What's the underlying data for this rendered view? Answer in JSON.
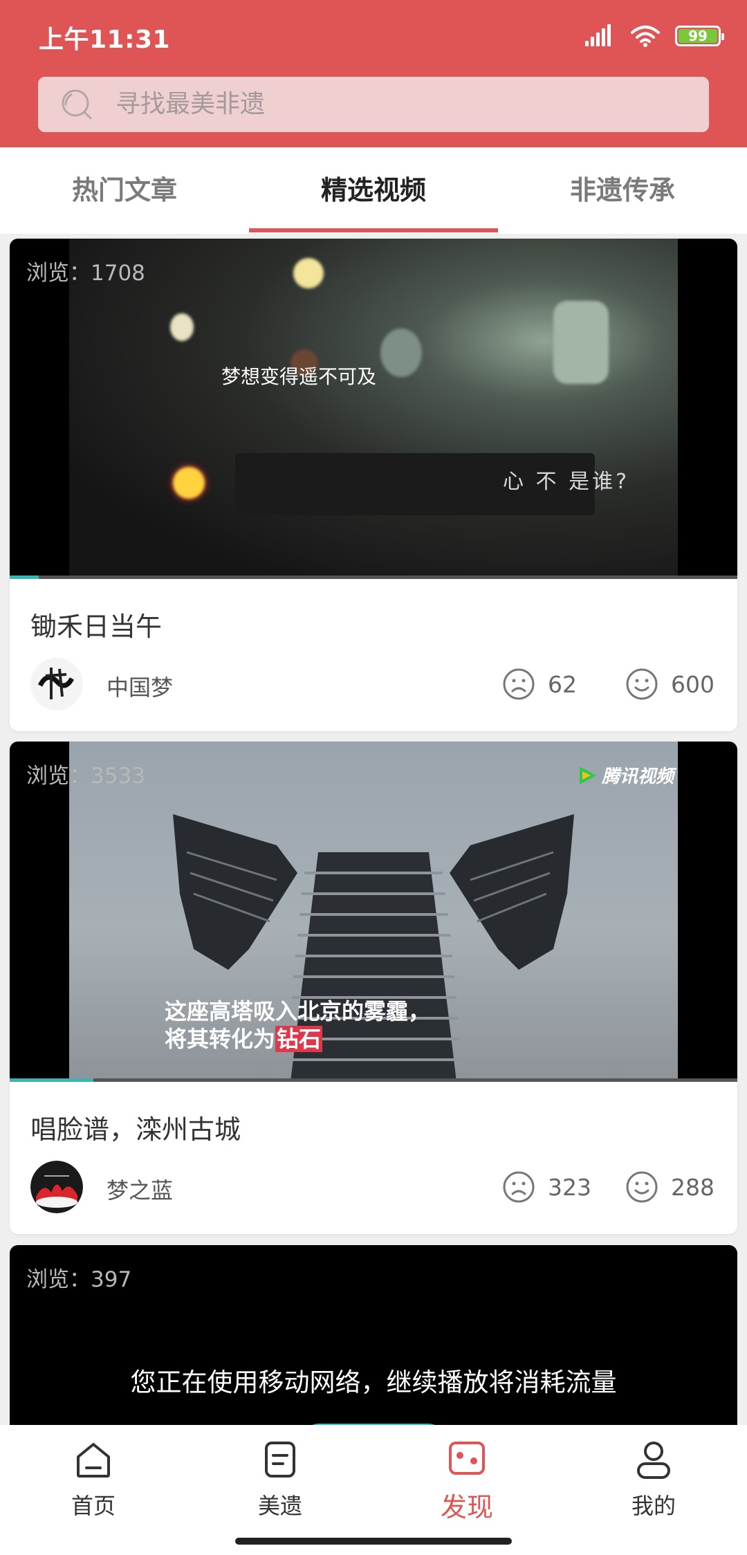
{
  "status_bar": {
    "time": "上午11:31",
    "battery": "99"
  },
  "search": {
    "placeholder": "寻找最美非遗"
  },
  "tabs": [
    {
      "label": "热门文章",
      "active": false
    },
    {
      "label": "精选视频",
      "active": true
    },
    {
      "label": "非遗传承",
      "active": false
    }
  ],
  "cards": [
    {
      "views": "浏览：1708",
      "subtitle_1": "梦想变得遥不可及",
      "subtitle_2": "心   不         是谁?",
      "progress": 0.04,
      "title": "锄禾日当午",
      "author": "中国梦",
      "dislikes": "62",
      "likes": "600"
    },
    {
      "views": "浏览：3533",
      "subtitle_line1": "这座高塔吸入北京的雾霾，",
      "subtitle_line2a": "将其转化为",
      "subtitle_line2b": "钻石",
      "watermark": "腾讯视频",
      "progress": 0.115,
      "title": "唱脸谱，滦州古城",
      "author": "梦之蓝",
      "dislikes": "323",
      "likes": "288"
    },
    {
      "views": "浏览：397",
      "warning": "您正在使用移动网络，继续播放将消耗流量"
    }
  ],
  "bottom_nav": [
    {
      "label": "首页",
      "icon": "home-icon",
      "active": false
    },
    {
      "label": "美遗",
      "icon": "document-icon",
      "active": false
    },
    {
      "label": "发现",
      "icon": "discover-icon",
      "active": true
    },
    {
      "label": "我的",
      "icon": "user-icon",
      "active": false
    }
  ],
  "colors": {
    "accent": "#df5454",
    "progress": "#37b6b2"
  }
}
